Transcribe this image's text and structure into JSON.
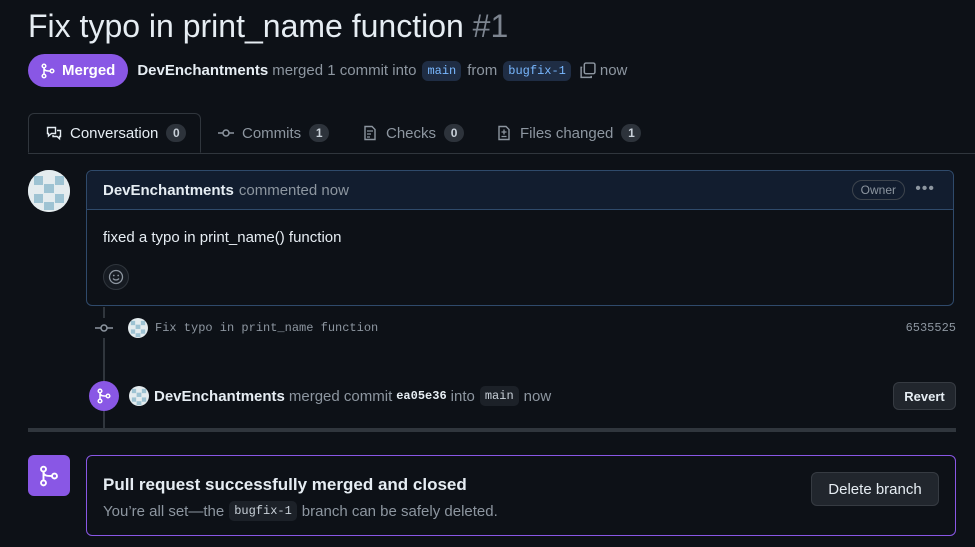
{
  "pr": {
    "title": "Fix typo in print_name function",
    "number": "#1",
    "status_label": "Merged",
    "author": "DevEnchantments",
    "merged_text": "merged 1 commit into",
    "base_branch": "main",
    "from_text": "from",
    "head_branch": "bugfix-1",
    "time": "now"
  },
  "tabs": [
    {
      "label": "Conversation",
      "count": "0",
      "icon": "comment-discussion-icon"
    },
    {
      "label": "Commits",
      "count": "1",
      "icon": "git-commit-icon"
    },
    {
      "label": "Checks",
      "count": "0",
      "icon": "checklist-icon"
    },
    {
      "label": "Files changed",
      "count": "1",
      "icon": "file-diff-icon"
    }
  ],
  "comment": {
    "author": "DevEnchantments",
    "meta": "commented now",
    "role_badge": "Owner",
    "body": "fixed a typo in print_name() function"
  },
  "commit": {
    "message": "Fix typo in print_name function",
    "sha": "6535525"
  },
  "merge_event": {
    "author": "DevEnchantments",
    "text": "merged commit",
    "sha": "ea05e36",
    "into_text": "into",
    "branch": "main",
    "time": "now",
    "revert_label": "Revert"
  },
  "merge_box": {
    "title": "Pull request successfully merged and closed",
    "sub_prefix": "You’re all set—the",
    "branch": "bugfix-1",
    "sub_suffix": "branch can be safely deleted.",
    "delete_label": "Delete branch"
  },
  "colors": {
    "background": "#0d1117",
    "merged_purple": "#8957e5",
    "muted_text": "#8d96a0",
    "branch_chip": "#1f2d44"
  }
}
